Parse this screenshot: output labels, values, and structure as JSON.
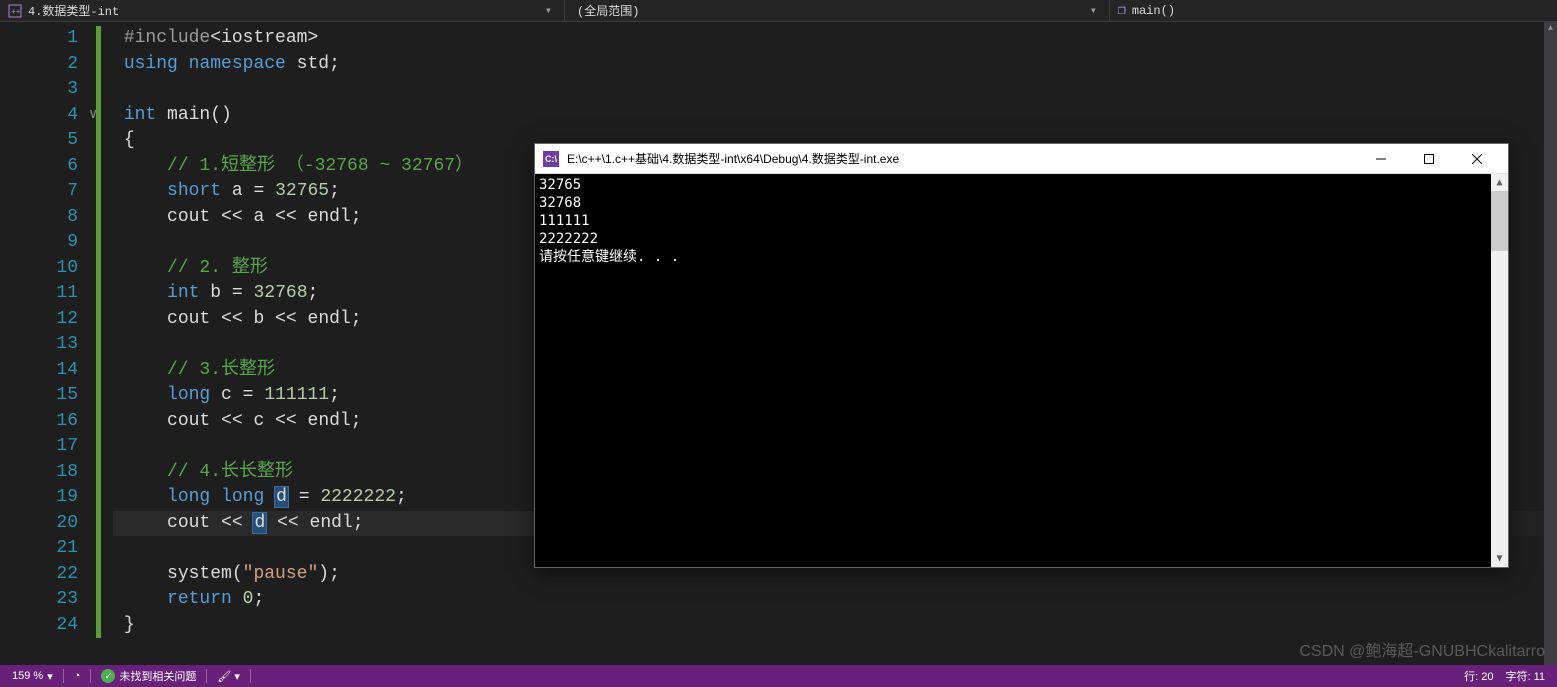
{
  "topbar": {
    "tab_title": "4.数据类型-int",
    "scope_label": "(全局范围)",
    "function_label": "main()"
  },
  "code": {
    "line1_include": "#include",
    "line1_header": "<iostream>",
    "line2_using": "using",
    "line2_ns": "namespace",
    "line2_std": "std",
    "line4_int": "int",
    "line4_main": "main",
    "line6_cmt": "// 1.短整形 （-32768 ~ 32767）",
    "line7_short": "short",
    "line7_a": "a",
    "line7_val": "32765",
    "line8_cout": "cout",
    "line8_a": "a",
    "line8_endl": "endl",
    "line10_cmt": "// 2. 整形",
    "line11_int": "int",
    "line11_b": "b",
    "line11_val": "32768",
    "line12_cout": "cout",
    "line12_b": "b",
    "line12_endl": "endl",
    "line14_cmt": "// 3.长整形",
    "line15_long": "long",
    "line15_c": "c",
    "line15_val": "111111",
    "line16_cout": "cout",
    "line16_c": "c",
    "line16_endl": "endl",
    "line18_cmt": "// 4.长长整形",
    "line19_long1": "long",
    "line19_long2": "long",
    "line19_d": "d",
    "line19_val": "2222222",
    "line20_cout": "cout",
    "line20_d": "d",
    "line20_endl": "endl",
    "line22_system": "system",
    "line22_arg": "\"pause\"",
    "line23_return": "return",
    "line23_zero": "0"
  },
  "line_numbers": [
    "1",
    "2",
    "3",
    "4",
    "5",
    "6",
    "7",
    "8",
    "9",
    "10",
    "11",
    "12",
    "13",
    "14",
    "15",
    "16",
    "17",
    "18",
    "19",
    "20",
    "21",
    "22",
    "23",
    "24"
  ],
  "console": {
    "title": "E:\\c++\\1.c++基础\\4.数据类型-int\\x64\\Debug\\4.数据类型-int.exe",
    "icon_text": "C:\\",
    "lines": [
      "32765",
      "32768",
      "111111",
      "2222222",
      "请按任意键继续. . ."
    ]
  },
  "status": {
    "zoom": "159 %",
    "issues": "未找到相关问题",
    "line": "行: 20",
    "col": "字符: 11"
  },
  "watermark": "CSDN @鲍海超-GNUBHCkalitarro"
}
